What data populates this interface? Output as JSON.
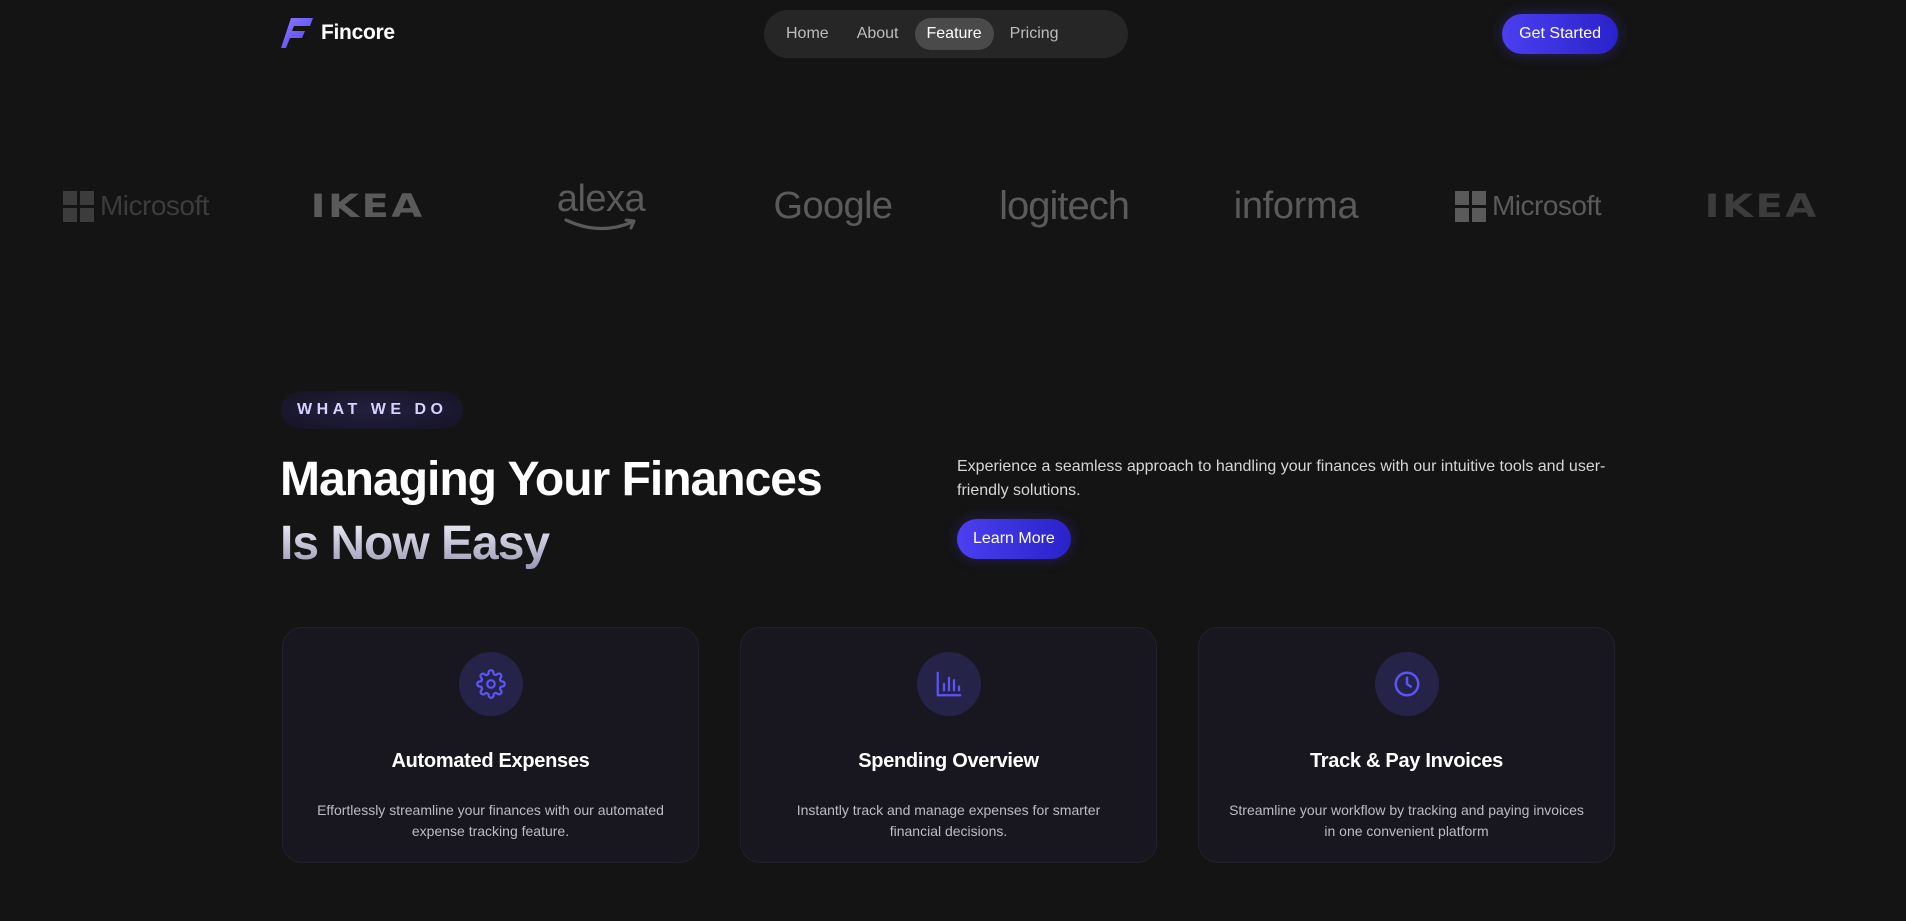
{
  "brand": {
    "name": "Fincore",
    "accent": "#4b3ff0"
  },
  "nav": {
    "links": [
      "Home",
      "About",
      "Feature",
      "Pricing"
    ],
    "active": "Feature",
    "cta": "Get Started"
  },
  "logo_strip": {
    "items": [
      "Microsoft",
      "IKEA",
      "alexa",
      "Google",
      "logitech",
      "informa",
      "Microsoft",
      "IKEA"
    ]
  },
  "section": {
    "tag": "WHAT WE DO",
    "headline_line1": "Managing Your Finances",
    "headline_line2": "Is Now Easy",
    "intro": "Experience a seamless approach to handling your finances with our intuitive tools and user-friendly solutions.",
    "cta": "Learn More"
  },
  "features": [
    {
      "icon": "gear-icon",
      "title": "Automated Expenses",
      "desc": "Effortlessly streamline your finances with our automated expense tracking feature."
    },
    {
      "icon": "bar-chart-icon",
      "title": "Spending Overview",
      "desc": "Instantly track and manage expenses for smarter financial decisions."
    },
    {
      "icon": "clock-icon",
      "title": "Track & Pay Invoices",
      "desc": "Streamline your workflow by tracking and paying invoices in one convenient platform"
    }
  ]
}
